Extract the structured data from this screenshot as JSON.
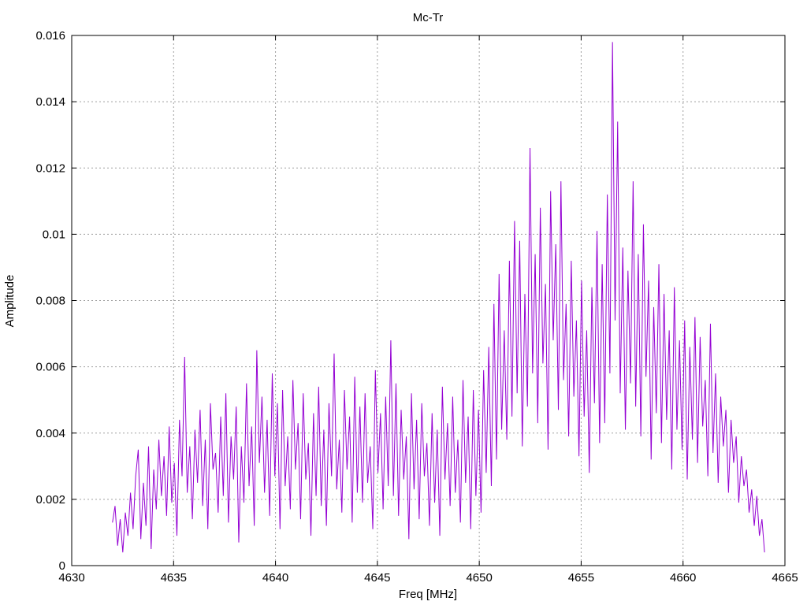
{
  "chart_data": {
    "type": "line",
    "title": "Mc-Tr",
    "xlabel": "Freq [MHz]",
    "ylabel": "Amplitude",
    "xlim": [
      4630,
      4665
    ],
    "ylim": [
      0,
      0.016
    ],
    "grid": true,
    "legend": "none",
    "x_ticks": [
      "4630",
      "4635",
      "4640",
      "4645",
      "4650",
      "4655",
      "4660",
      "4665"
    ],
    "y_ticks": [
      "0",
      "0.002",
      "0.004",
      "0.006",
      "0.008",
      "0.01",
      "0.012",
      "0.014",
      "0.016"
    ],
    "series": [
      {
        "color": "#9400d3",
        "x_start": 4632.0,
        "x_end": 4664.0,
        "values": [
          0.0013,
          0.0018,
          0.0006,
          0.0014,
          0.0004,
          0.0016,
          0.0009,
          0.0022,
          0.0011,
          0.0027,
          0.0035,
          0.0008,
          0.0025,
          0.0012,
          0.0036,
          0.0005,
          0.0029,
          0.0017,
          0.0038,
          0.0021,
          0.0033,
          0.0015,
          0.0042,
          0.0019,
          0.0031,
          0.0009,
          0.0044,
          0.0027,
          0.0063,
          0.0022,
          0.0036,
          0.0014,
          0.0041,
          0.0025,
          0.0047,
          0.0018,
          0.0038,
          0.0011,
          0.0049,
          0.0029,
          0.0034,
          0.0016,
          0.0045,
          0.0021,
          0.0052,
          0.0013,
          0.0039,
          0.0026,
          0.0048,
          0.0007,
          0.0036,
          0.0019,
          0.0055,
          0.0024,
          0.0042,
          0.0012,
          0.0065,
          0.0031,
          0.0051,
          0.0022,
          0.0044,
          0.0015,
          0.0058,
          0.0027,
          0.0049,
          0.0011,
          0.0053,
          0.0024,
          0.0039,
          0.0017,
          0.0056,
          0.0029,
          0.0043,
          0.0014,
          0.0052,
          0.0026,
          0.0037,
          0.0009,
          0.0046,
          0.0021,
          0.0054,
          0.0018,
          0.0041,
          0.0012,
          0.0049,
          0.0027,
          0.0064,
          0.0023,
          0.0038,
          0.0016,
          0.0053,
          0.0029,
          0.0045,
          0.0013,
          0.0057,
          0.0022,
          0.0048,
          0.0019,
          0.0052,
          0.0025,
          0.0036,
          0.0011,
          0.0059,
          0.0028,
          0.0046,
          0.0017,
          0.0051,
          0.0024,
          0.0068,
          0.0021,
          0.0055,
          0.0015,
          0.0047,
          0.0026,
          0.0039,
          0.0008,
          0.0052,
          0.0023,
          0.0044,
          0.0014,
          0.0049,
          0.0027,
          0.0037,
          0.0012,
          0.0046,
          0.0019,
          0.0041,
          0.0009,
          0.0054,
          0.0026,
          0.0043,
          0.0018,
          0.0051,
          0.0022,
          0.0038,
          0.0013,
          0.0056,
          0.0025,
          0.0045,
          0.0011,
          0.0053,
          0.0021,
          0.0047,
          0.0016,
          0.0059,
          0.0028,
          0.0066,
          0.0024,
          0.0079,
          0.0032,
          0.0088,
          0.0041,
          0.0071,
          0.0038,
          0.0092,
          0.0045,
          0.0104,
          0.0052,
          0.0098,
          0.0036,
          0.0082,
          0.0048,
          0.0126,
          0.0058,
          0.0094,
          0.0043,
          0.0108,
          0.0061,
          0.0085,
          0.0035,
          0.0113,
          0.0068,
          0.0097,
          0.0047,
          0.0116,
          0.0056,
          0.0079,
          0.0039,
          0.0092,
          0.0051,
          0.0074,
          0.0033,
          0.0086,
          0.0045,
          0.0071,
          0.0028,
          0.0084,
          0.0049,
          0.0101,
          0.0037,
          0.0091,
          0.0043,
          0.0112,
          0.0058,
          0.0158,
          0.0074,
          0.0134,
          0.0052,
          0.0096,
          0.0041,
          0.0089,
          0.0055,
          0.0116,
          0.0048,
          0.0094,
          0.0039,
          0.0103,
          0.0057,
          0.0086,
          0.0032,
          0.0078,
          0.0046,
          0.0091,
          0.0037,
          0.0082,
          0.0044,
          0.0071,
          0.0029,
          0.0084,
          0.0041,
          0.0068,
          0.0035,
          0.0074,
          0.0026,
          0.0066,
          0.0038,
          0.0075,
          0.0031,
          0.0069,
          0.0042,
          0.0056,
          0.0027,
          0.0073,
          0.0034,
          0.0058,
          0.0025,
          0.0051,
          0.0036,
          0.0047,
          0.0022,
          0.0044,
          0.0031,
          0.0039,
          0.0019,
          0.0033,
          0.0024,
          0.0029,
          0.0016,
          0.0023,
          0.0012,
          0.0021,
          0.0009,
          0.0014,
          0.0004
        ]
      }
    ]
  }
}
